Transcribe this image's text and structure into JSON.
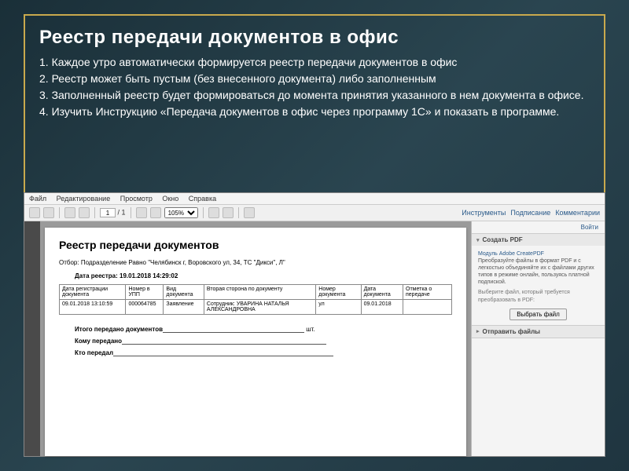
{
  "slide": {
    "title": "Реестр передачи документов в офис",
    "p1": "1. Каждое утро автоматически формируется реестр передачи документов  в офис",
    "p2": "2. Реестр может быть  пустым (без  внесенного документа)  либо заполненным",
    "p3": "3. Заполненный реестр будет формироваться до момента принятия указанного в нем документа в офисе.",
    "p4": "4. Изучить Инструкцию «Передача документов в офис через программу 1С» и показать в программе."
  },
  "menu": {
    "file": "Файл",
    "edit": "Редактирование",
    "view": "Просмотр",
    "window": "Окно",
    "help": "Справка"
  },
  "toolbar": {
    "page_current": "1",
    "page_sep": "/",
    "page_total": "1",
    "zoom": "105%",
    "tools": "Инструменты",
    "sign": "Подписание",
    "comments": "Комментарии"
  },
  "doc": {
    "title": "Реестр передачи документов",
    "filter_label": "Отбор:",
    "filter_value": "Подразделение Равно \"Челябинск г, Воровского ул, 34, ТС \"Дикси\", Л\"",
    "date_label": "Дата реестра: 19.01.2018 14:29:02",
    "headers": {
      "h1": "Дата регистрации документа",
      "h2": "Номер в УПП",
      "h3": "Вид документа",
      "h4": "Вторая сторона по документу",
      "h5": "Номер документа",
      "h6": "Дата документа",
      "h7": "Отметка о передаче"
    },
    "row": {
      "c1": "09.01.2018 13:10:59",
      "c2": "000064785",
      "c3": "Заявление",
      "c4": "Сотрудник: УВАРИНА НАТАЛЬЯ АЛЕКСАНДРОВНА",
      "c5": "ул",
      "c6": "09.01.2018",
      "c7": ""
    },
    "total_label": "Итого передано документов",
    "total_unit": "шт.",
    "to_whom": "Кому передано",
    "who": "Кто передал"
  },
  "side": {
    "login": "Войти",
    "create": "Создать PDF",
    "module": "Модуль Adobe CreatePDF",
    "desc": "Преобразуйте файлы в формат PDF и с легкостью объединяйте их с файлами других типов в режиме онлайн, пользуясь платной подпиской.",
    "select_hint": "Выберите файл, который требуется преобразовать в PDF:",
    "select_btn": "Выбрать файл",
    "send": "Отправить файлы"
  }
}
